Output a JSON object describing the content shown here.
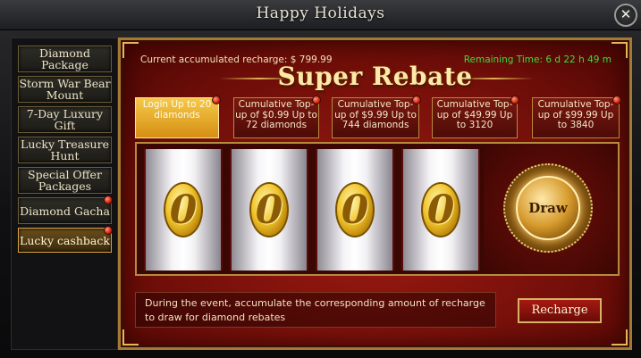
{
  "window": {
    "title": "Happy Holidays",
    "close_glyph": "✕"
  },
  "sidebar": {
    "items": [
      {
        "label": "Diamond Package"
      },
      {
        "label": "Storm War Bear Mount"
      },
      {
        "label": "7-Day Luxury Gift"
      },
      {
        "label": "Lucky Treasure Hunt"
      },
      {
        "label": "Special Offer Packages"
      },
      {
        "label": "Diamond Gacha",
        "badge": true
      },
      {
        "label": "Lucky cashback",
        "badge": true,
        "active": true
      }
    ]
  },
  "panel": {
    "recharge_info": "Current accumulated recharge: $ 799.99",
    "remaining_time": "Remaining Time: 6 d 22 h 49 m",
    "banner_title": "Super Rebate",
    "tabs": [
      {
        "label": "Login Up to 20 diamonds",
        "active": true
      },
      {
        "label": "Cumulative Top-up of $0.99 Up to 72 diamonds"
      },
      {
        "label": "Cumulative Top-up of $9.99 Up to 744 diamonds"
      },
      {
        "label": "Cumulative Top-up of $49.99 Up to 3120"
      },
      {
        "label": "Cumulative Top-up of $99.99 Up to 3840"
      }
    ],
    "reels": [
      "0",
      "0",
      "0",
      "0"
    ],
    "draw_label": "Draw",
    "description": "During the event, accumulate the corresponding amount of recharge to draw for diamond rebates",
    "recharge_label": "Recharge"
  },
  "colors": {
    "accent_gold": "#e3b75a",
    "panel_red": "#9e1a12",
    "time_green": "#3bdc3b"
  }
}
